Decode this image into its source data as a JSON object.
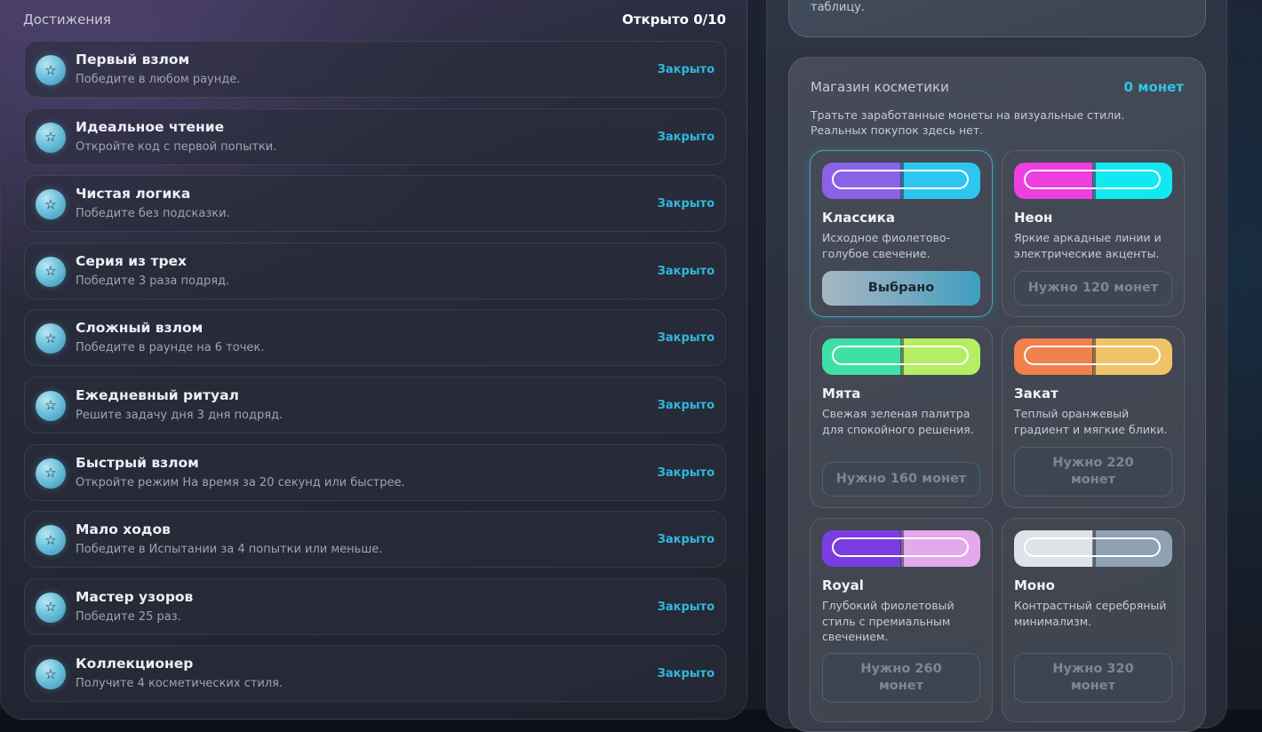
{
  "achievements": {
    "title": "Достижения",
    "counter": "Открыто 0/10",
    "items": [
      {
        "name": "Первый взлом",
        "desc": "Победите в любом раунде.",
        "status": "Закрыто"
      },
      {
        "name": "Идеальное чтение",
        "desc": "Откройте код с первой попытки.",
        "status": "Закрыто"
      },
      {
        "name": "Чистая логика",
        "desc": "Победите без подсказки.",
        "status": "Закрыто"
      },
      {
        "name": "Серия из трех",
        "desc": "Победите 3 раза подряд.",
        "status": "Закрыто"
      },
      {
        "name": "Сложный взлом",
        "desc": "Победите в раунде на 6 точек.",
        "status": "Закрыто"
      },
      {
        "name": "Ежедневный ритуал",
        "desc": "Решите задачу дня 3 дня подряд.",
        "status": "Закрыто"
      },
      {
        "name": "Быстрый взлом",
        "desc": "Откройте режим На время за 20 секунд или быстрее.",
        "status": "Закрыто"
      },
      {
        "name": "Мало ходов",
        "desc": "Победите в Испытании за 4 попытки или меньше.",
        "status": "Закрыто"
      },
      {
        "name": "Мастер узоров",
        "desc": "Победите 25 раз.",
        "status": "Закрыто"
      },
      {
        "name": "Коллекционер",
        "desc": "Получите 4 косметических стиля.",
        "status": "Закрыто"
      }
    ],
    "badge_icon": "star-icon",
    "badge_glyph": "☆"
  },
  "top_card": {
    "text_fragment": "таблицу."
  },
  "shop": {
    "title": "Магазин косметики",
    "coins": "0 монет",
    "desc_line1": "Тратьте заработанные монеты на визуальные стили.",
    "desc_line2": "Реальных покупок здесь нет.",
    "skins": [
      {
        "name": "Классика",
        "desc": "Исходное фиолетово-голубое свечение.",
        "button": "Выбрано",
        "selected": true,
        "colors": [
          "#8a62e6",
          "#2cc6ee"
        ]
      },
      {
        "name": "Неон",
        "desc": "Яркие аркадные линии и электрические акценты.",
        "button": "Нужно 120 монет",
        "selected": false,
        "colors": [
          "#ee3fe0",
          "#12e8f0"
        ]
      },
      {
        "name": "Мята",
        "desc": "Свежая зеленая палитра для спокойного решения.",
        "button": "Нужно 160 монет",
        "selected": false,
        "colors": [
          "#3fe0a6",
          "#b5ee62"
        ]
      },
      {
        "name": "Закат",
        "desc": "Теплый оранжевый градиент и мягкие блики.",
        "button": "Нужно 220 монет",
        "selected": false,
        "colors": [
          "#f0804c",
          "#f0c466"
        ]
      },
      {
        "name": "Royal",
        "desc": "Глубокий фиолетовый стиль с премиальным свечением.",
        "button": "Нужно 260 монет",
        "selected": false,
        "colors": [
          "#7a3ee0",
          "#e4a8ec"
        ]
      },
      {
        "name": "Моно",
        "desc": "Контрастный серебряный минимализм.",
        "button": "Нужно 320 монет",
        "selected": false,
        "colors": [
          "#dfe2e6",
          "#8ea2b4"
        ]
      }
    ]
  },
  "colors": {
    "accent": "#2fb8dc",
    "coins": "#2fc4ea"
  }
}
